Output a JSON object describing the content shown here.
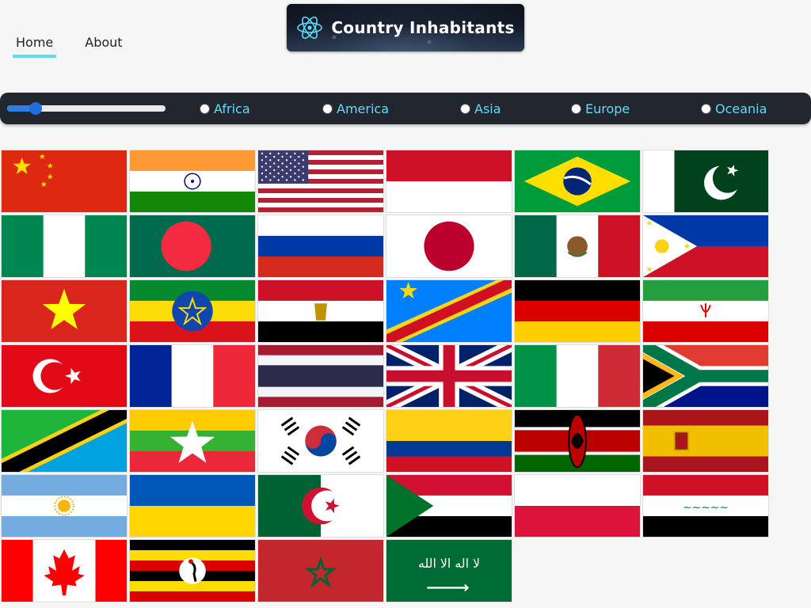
{
  "nav": {
    "items": [
      {
        "label": "Home",
        "active": true
      },
      {
        "label": "About",
        "active": false
      }
    ]
  },
  "banner": {
    "title": "Country Inhabitants",
    "icon": "react-atom-icon"
  },
  "filter": {
    "slider_value": 0.18,
    "regions": [
      "Africa",
      "America",
      "Asia",
      "Europe",
      "Oceania"
    ],
    "accent": "#61dafb"
  },
  "flags": [
    "China",
    "India",
    "United States",
    "Indonesia",
    "Brazil",
    "Pakistan",
    "Nigeria",
    "Bangladesh",
    "Russia",
    "Japan",
    "Mexico",
    "Philippines",
    "Vietnam",
    "Ethiopia",
    "Egypt",
    "DR Congo",
    "Germany",
    "Iran",
    "Turkey",
    "France",
    "Thailand",
    "United Kingdom",
    "Italy",
    "South Africa",
    "Tanzania",
    "Myanmar",
    "South Korea",
    "Colombia",
    "Kenya",
    "Spain",
    "Argentina",
    "Ukraine",
    "Algeria",
    "Sudan",
    "Poland",
    "Iraq",
    "Canada",
    "Uganda",
    "Morocco",
    "Saudi Arabia"
  ]
}
